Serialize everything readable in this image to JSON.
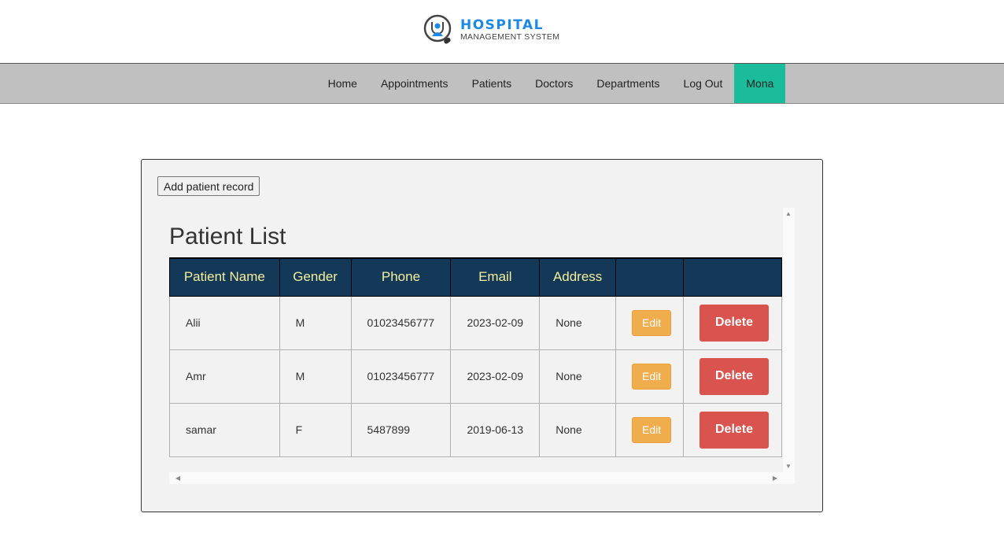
{
  "logo": {
    "line1": "HOSPITAL",
    "line2": "MANAGEMENT SYSTEM"
  },
  "nav": {
    "items": [
      "Home",
      "Appointments",
      "Patients",
      "Doctors",
      "Departments",
      "Log Out",
      "Mona"
    ],
    "active": "Mona",
    "active_color": "#1abc9c"
  },
  "main": {
    "add_button": "Add patient record",
    "title": "Patient List",
    "columns": [
      "Patient Name",
      "Gender",
      "Phone",
      "Email",
      "Address",
      "",
      ""
    ],
    "rows": [
      {
        "name": "Alii",
        "gender": "M",
        "phone": "01023456777",
        "email": "2023-02-09",
        "address": "None"
      },
      {
        "name": "Amr",
        "gender": "M",
        "phone": "01023456777",
        "email": "2023-02-09",
        "address": "None"
      },
      {
        "name": "samar",
        "gender": "F",
        "phone": "5487899",
        "email": "2019-06-13",
        "address": "None"
      }
    ],
    "edit_label": "Edit",
    "delete_label": "Delete"
  }
}
